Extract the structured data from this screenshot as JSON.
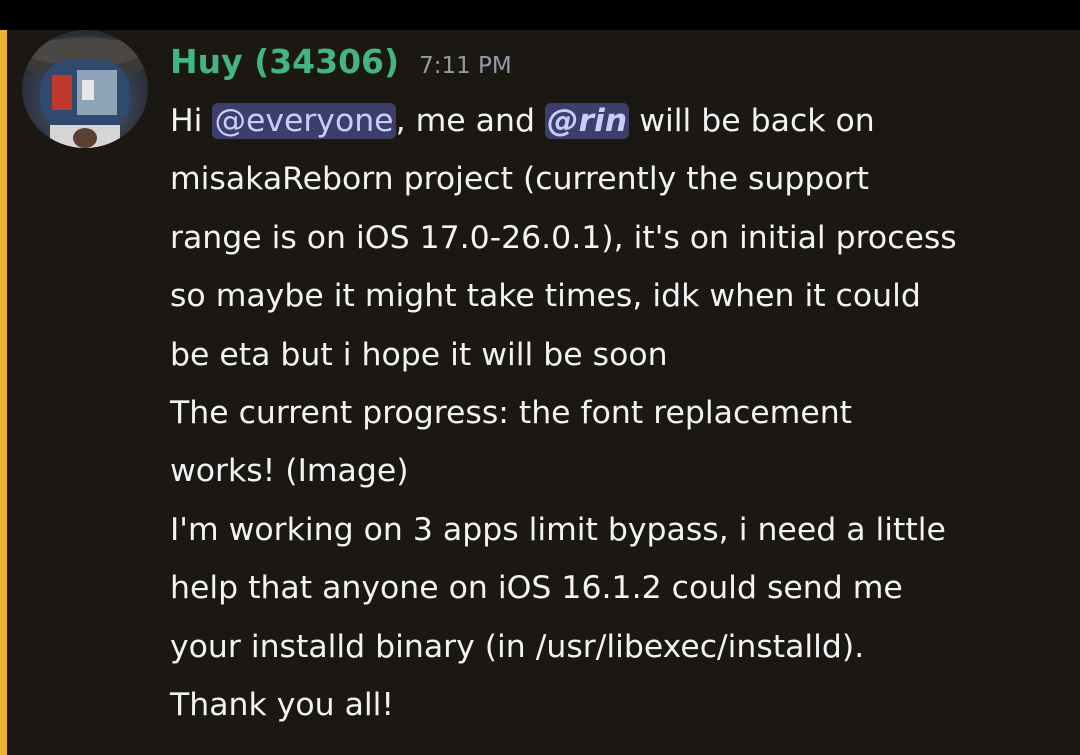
{
  "message": {
    "author": "Huy (34306)",
    "timestamp": "7:11 PM",
    "avatar_icon": "avatar-icon",
    "accent_color": "#f0b232",
    "username_color": "#43b581",
    "lines": [
      {
        "pre": "Hi ",
        "mention1": "@everyone",
        "mid": ", me and ",
        "mention2": "@rin",
        "post": " will be back on"
      },
      "misakaReborn project (currently the support",
      "range is on iOS 17.0-26.0.1), it's on initial process",
      "so maybe it might take times, idk when it could",
      "be eta but i hope it will be soon",
      "The current progress: the font replacement",
      "works! (Image)",
      "I'm working on 3 apps limit bypass, i need a little",
      "help that anyone on iOS 16.1.2 could send me",
      "your installd binary (in /usr/libexec/installd).",
      "Thank you all!"
    ]
  }
}
